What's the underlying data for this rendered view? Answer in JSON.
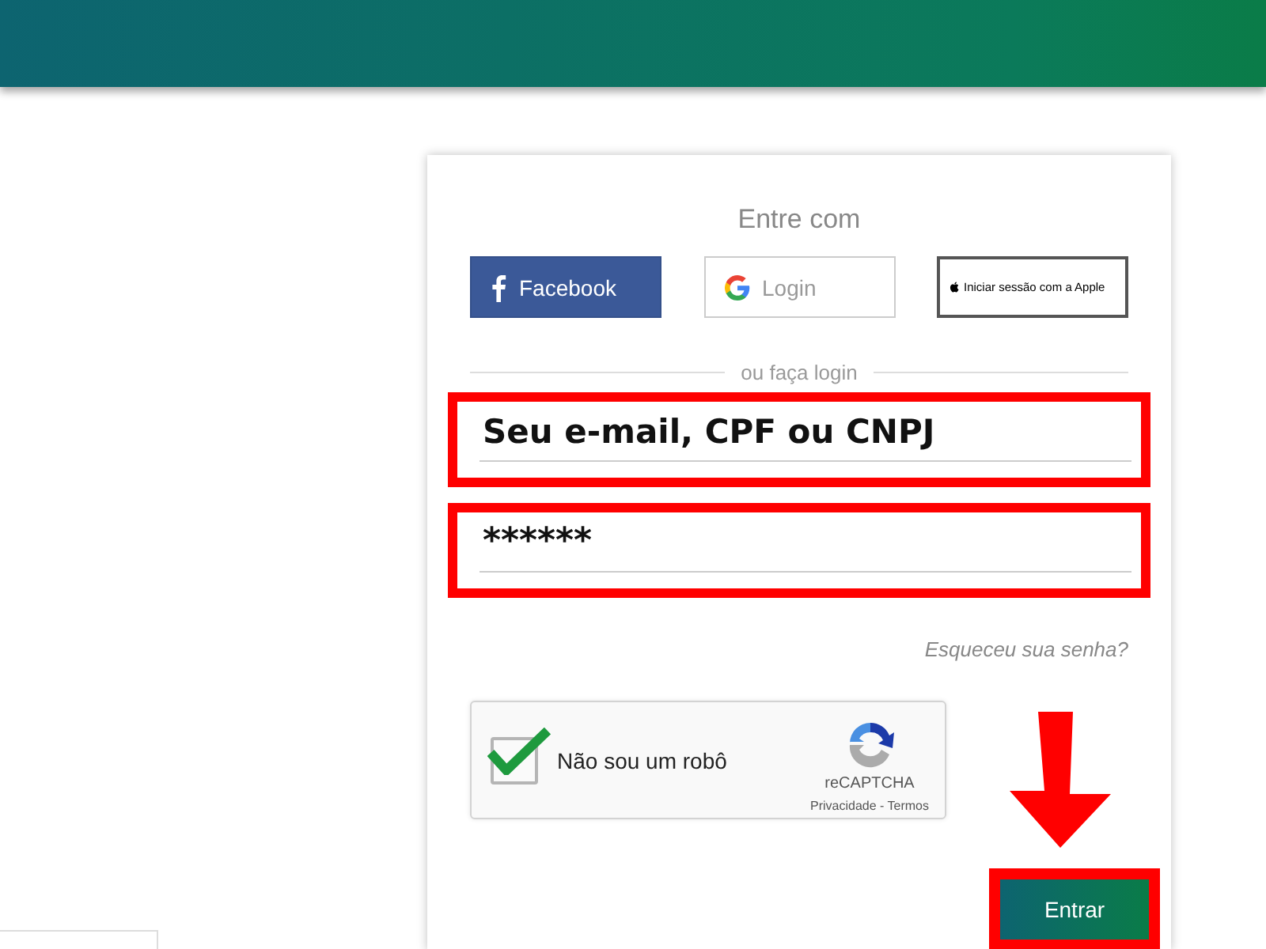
{
  "login": {
    "heading": "Entre com",
    "social_buttons": [
      {
        "kind": "facebook",
        "label": "Facebook"
      },
      {
        "kind": "google",
        "label": "Login"
      },
      {
        "kind": "apple",
        "label": "Iniciar sessão com a Apple"
      }
    ],
    "divider": "ou faça login",
    "fields": [
      {
        "kind": "text",
        "value": "Seu e-mail, CPF ou CNPJ",
        "highlighted": true
      },
      {
        "kind": "password",
        "value": "******",
        "highlighted": true
      }
    ],
    "forgot_link": "Esqueceu sua senha?",
    "captcha": {
      "label": "Não sou um robô",
      "checked": true,
      "brand": "reCAPTCHA",
      "links": "Privacidade - Termos"
    },
    "submit": {
      "label": "Entrar",
      "highlighted": true
    }
  }
}
